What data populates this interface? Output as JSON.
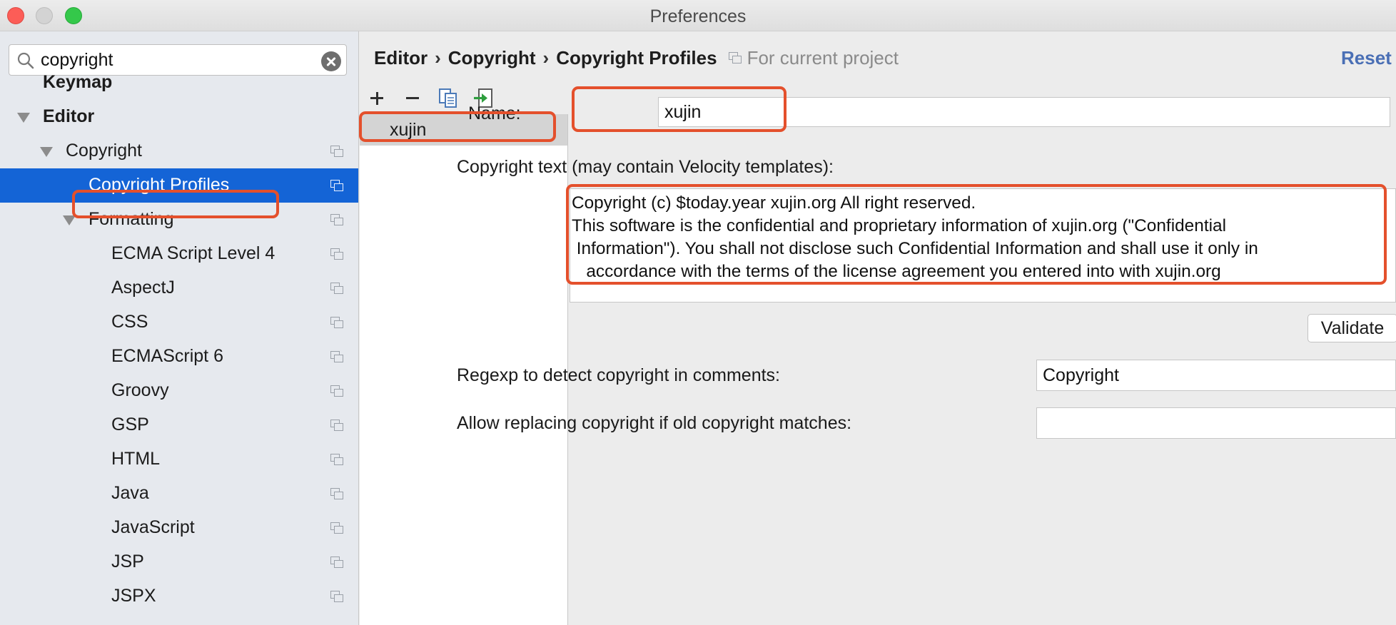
{
  "window": {
    "title": "Preferences"
  },
  "search": {
    "value": "copyright"
  },
  "tree": {
    "keymap": "Keymap",
    "editor": "Editor",
    "copyright": "Copyright",
    "copyright_profiles": "Copyright Profiles",
    "formatting": "Formatting",
    "languages": [
      "ECMA Script Level 4",
      "AspectJ",
      "CSS",
      "ECMAScript 6",
      "Groovy",
      "GSP",
      "HTML",
      "Java",
      "JavaScript",
      "JSP",
      "JSPX"
    ]
  },
  "breadcrumb": {
    "items": [
      "Editor",
      "Copyright",
      "Copyright Profiles"
    ],
    "separator": "›",
    "scope": "For current project"
  },
  "header": {
    "reset_label": "Reset"
  },
  "profiles": {
    "items": [
      "xujin"
    ]
  },
  "form": {
    "name_label": "Name:",
    "name_value": "xujin",
    "copyright_text_label": "Copyright text (may contain Velocity templates):",
    "copyright_text_value": "Copyright (c) $today.year xujin.org All right reserved.\nThis software is the confidential and proprietary information of xujin.org (\"Confidential\n Information\"). You shall not disclose such Confidential Information and shall use it only in\n   accordance with the terms of the license agreement you entered into with xujin.org",
    "validate_label": "Validate",
    "regexp_label": "Regexp to detect copyright in comments:",
    "regexp_value": "Copyright",
    "replace_label": "Allow replacing copyright if old copyright matches:",
    "replace_value": ""
  },
  "colors": {
    "selection": "#1464d6",
    "annotation": "#e4502c",
    "link": "#4a6fb5"
  }
}
